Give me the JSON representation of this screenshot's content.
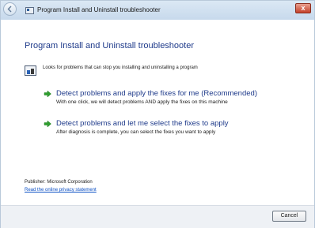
{
  "window": {
    "title": "Program Install and Uninstall troubleshooter",
    "close_label": "x"
  },
  "main": {
    "heading": "Program Install and Uninstall troubleshooter",
    "description": "Looks for problems that can stop you installing and uninstalling a program",
    "options": [
      {
        "title": "Detect problems and apply the fixes for me (Recommended)",
        "description": "With one click, we will detect problems AND apply the fixes on this machine"
      },
      {
        "title": "Detect problems and let me select the fixes to apply",
        "description": "After diagnosis is complete, you can select the fixes you want to apply"
      }
    ],
    "publisher": "Publisher: Microsoft Corporation",
    "privacy_link": "Read the online privacy statement"
  },
  "footer": {
    "cancel_label": "Cancel"
  },
  "colors": {
    "heading": "#1e3a8a",
    "arrow": "#2e9e2e",
    "link": "#0b4fc4",
    "close": "#c4412a"
  }
}
